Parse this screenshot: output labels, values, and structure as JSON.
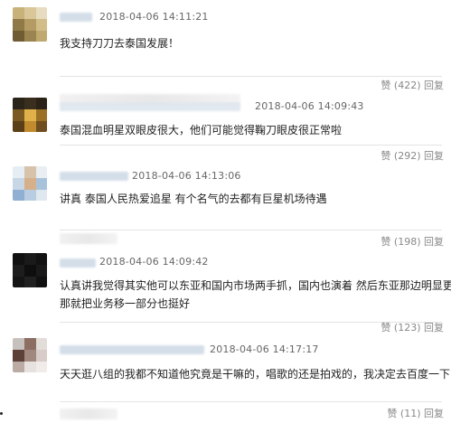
{
  "comments": [
    {
      "timestamp": "2018-04-06 14:11:21",
      "text": "我支持刀刀去泰国发展！",
      "likes": "赞 (422)  回复"
    },
    {
      "timestamp": "2018-04-06 14:09:43",
      "text": "泰国混血明星双眼皮很大，他们可能觉得鞠刀眼皮很正常啦",
      "likes": "赞 (292)  回复"
    },
    {
      "timestamp": "2018-04-06 14:13:06",
      "text": "讲真 泰国人民热爱追星 有个名气的去都有巨星机场待遇",
      "likes": "赞 (198)  回复"
    },
    {
      "timestamp": "2018-04-06 14:09:42",
      "text": "认真讲我觉得其实他可以东亚和国内市场两手抓，国内也演着 然后东亚那边明显更受接",
      "text2": "那就把业务移一部分也挺好",
      "likes": "赞 (123)  回复"
    },
    {
      "timestamp": "2018-04-06 14:17:17",
      "text": "天天逛八组的我都不知道他究竟是干嘛的，唱歌的还是拍戏的，我决定去百度一下",
      "likes": "赞 (11)  回复"
    }
  ]
}
